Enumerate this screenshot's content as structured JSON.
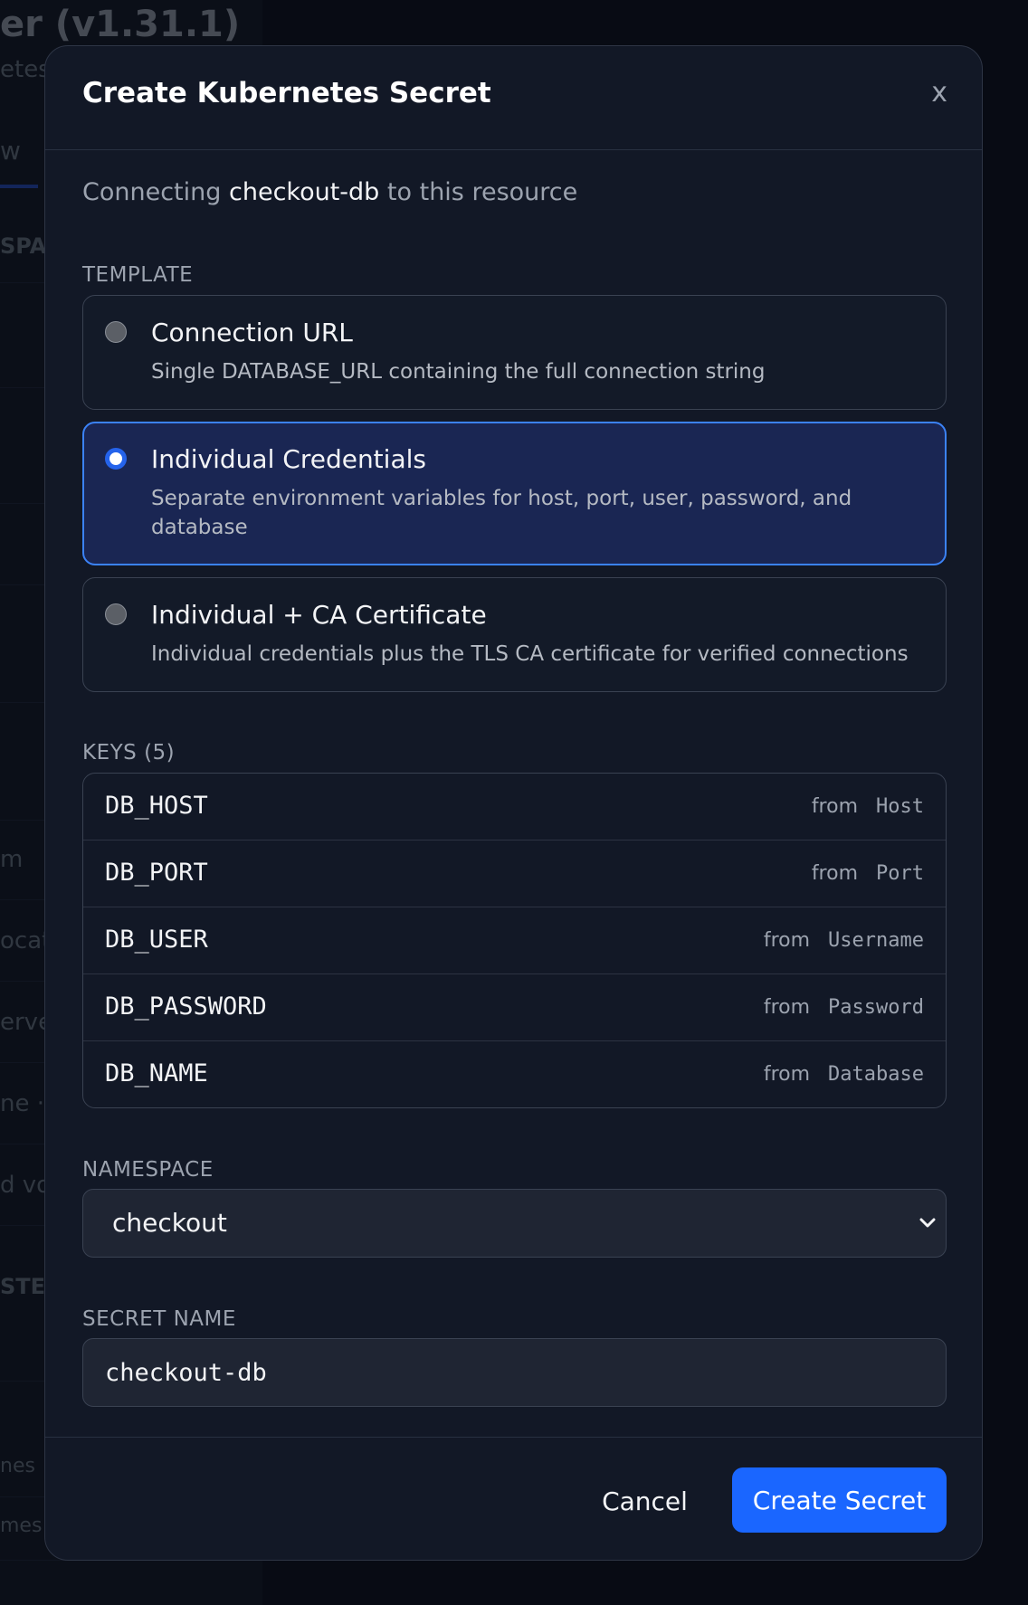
{
  "background": {
    "title": "er (v1.31.1)",
    "subtitle": "etes",
    "tab": "w",
    "section1": "SPAC",
    "items": [
      "m",
      "ocat",
      "erve",
      "ne ·",
      "d vo"
    ],
    "section2": "STER",
    "bottom_items": [
      "nes",
      "mes"
    ]
  },
  "modal": {
    "title": "Create Kubernetes Secret",
    "close_label": "x",
    "intro_prefix": "Connecting",
    "resource_name": "checkout-db",
    "intro_suffix": "to this resource"
  },
  "template": {
    "label": "TEMPLATE",
    "options": [
      {
        "title": "Connection URL",
        "desc": "Single DATABASE_URL containing the full connection string",
        "selected": false
      },
      {
        "title": "Individual Credentials",
        "desc": "Separate environment variables for host, port, user, password, and database",
        "selected": true
      },
      {
        "title": "Individual + CA Certificate",
        "desc": "Individual credentials plus the TLS CA certificate for verified connections",
        "selected": false
      }
    ]
  },
  "keys": {
    "label": "KEYS (5)",
    "from_label": "from",
    "rows": [
      {
        "name": "DB_HOST",
        "source": "Host"
      },
      {
        "name": "DB_PORT",
        "source": "Port"
      },
      {
        "name": "DB_USER",
        "source": "Username"
      },
      {
        "name": "DB_PASSWORD",
        "source": "Password"
      },
      {
        "name": "DB_NAME",
        "source": "Database"
      }
    ]
  },
  "namespace": {
    "label": "NAMESPACE",
    "value": "checkout"
  },
  "secret_name": {
    "label": "SECRET NAME",
    "value": "checkout-db"
  },
  "footer": {
    "cancel_label": "Cancel",
    "create_label": "Create Secret"
  },
  "colors": {
    "accent": "#1a66ff",
    "selected_bg": "#1a2653",
    "selected_border": "#3b82f6"
  }
}
